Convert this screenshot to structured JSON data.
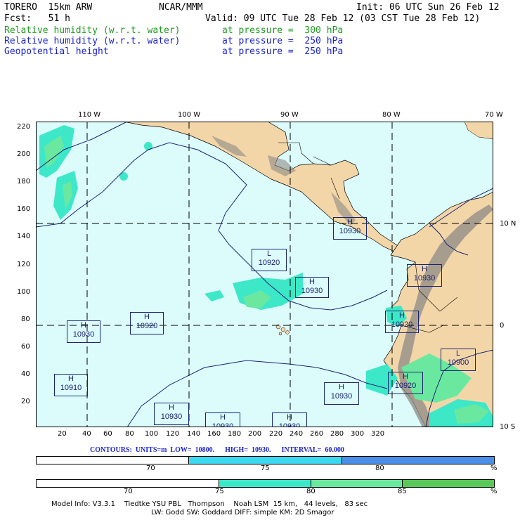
{
  "header": {
    "model": "TORERO  15km ARW",
    "org": "NCAR/MMM",
    "init": "Init: 06 UTC Sun 26 Feb 12",
    "fcst": "Fcst:   51 h",
    "valid": "Valid: 09 UTC Tue 28 Feb 12 (03 CST Tue 28 Feb 12)",
    "fields": [
      {
        "name": "Relative humidity (w.r.t. water)",
        "level": "at pressure =  300 hPa",
        "color": "#1f9a1f"
      },
      {
        "name": "Relative humidity (w.r.t. water)",
        "level": "at pressure =  250 hPa",
        "color": "#1a23c8"
      },
      {
        "name": "Geopotential height",
        "level": "at pressure =  250 hPa",
        "color": "#1a23c8"
      }
    ]
  },
  "map": {
    "lon_labels": [
      "110 W",
      "100 W",
      "90 W",
      "80 W",
      "70 W"
    ],
    "lat_labels": [
      "10 N",
      "0",
      "10 S"
    ],
    "y_ticks": [
      "220",
      "200",
      "180",
      "160",
      "140",
      "120",
      "100",
      "80",
      "60",
      "40",
      "20"
    ],
    "x_ticks": [
      "20",
      "40",
      "60",
      "80",
      "100",
      "120",
      "140",
      "160",
      "180",
      "200",
      "220",
      "240",
      "260",
      "280",
      "300",
      "320"
    ],
    "centers": [
      {
        "type": "H",
        "value": "10930"
      },
      {
        "type": "L",
        "value": "10920"
      },
      {
        "type": "H",
        "value": "10930"
      },
      {
        "type": "H",
        "value": "10930"
      },
      {
        "type": "H",
        "value": "10920"
      },
      {
        "type": "H",
        "value": "10920"
      },
      {
        "type": "H",
        "value": "10930"
      },
      {
        "type": "L",
        "value": "10900"
      },
      {
        "type": "H",
        "value": "10910"
      },
      {
        "type": "H",
        "value": "10920"
      },
      {
        "type": "H",
        "value": "10930"
      },
      {
        "type": "H",
        "value": "10930"
      },
      {
        "type": "H",
        "value": "10930"
      },
      {
        "type": "H",
        "value": "10930"
      }
    ],
    "colors": {
      "ocean": "#dcfcfc",
      "land": "#f3d6a8",
      "terrain": "#8d8a86",
      "contour": "#1a2370"
    }
  },
  "contours_line": "CONTOURS:  UNITS=m  LOW=  10800.      HIGH=  10930.      INTERVAL=  60.000",
  "scale_250": {
    "labels": [
      "70",
      "75",
      "80",
      "%"
    ],
    "colors": [
      "#ffffff",
      "#3cd8f0",
      "#4a90e8"
    ]
  },
  "scale_300": {
    "labels": [
      "70",
      "75",
      "80",
      "85",
      "%"
    ],
    "colors": [
      "#ffffff",
      "#3ce8c8",
      "#6ae8a0",
      "#58c858"
    ]
  },
  "footer": {
    "line1": "Model Info: V3.3.1    Tiedtke YSU PBL   Thompson    Noah LSM  15 km,   44 levels,   83 sec",
    "line2": "LW: Godd SW: Goddard DIFF: simple KM: 2D Smagor"
  }
}
